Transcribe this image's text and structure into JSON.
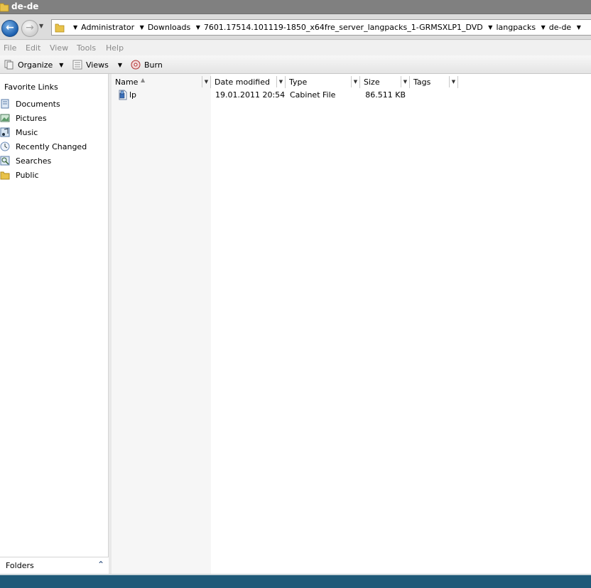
{
  "window": {
    "title": "de-de"
  },
  "address": {
    "crumbs": [
      "Administrator",
      "Downloads",
      "7601.17514.101119-1850_x64fre_server_langpacks_1-GRMSXLP1_DVD",
      "langpacks",
      "de-de"
    ]
  },
  "menu": {
    "items": [
      "File",
      "Edit",
      "View",
      "Tools",
      "Help"
    ]
  },
  "toolbar": {
    "organize_label": "Organize",
    "views_label": "Views",
    "burn_label": "Burn"
  },
  "nav": {
    "favorites_title": "Favorite Links",
    "items": [
      {
        "label": "Documents",
        "icon": "documents-icon"
      },
      {
        "label": "Pictures",
        "icon": "pictures-icon"
      },
      {
        "label": "Music",
        "icon": "music-icon"
      },
      {
        "label": "Recently Changed",
        "icon": "recently-changed-icon"
      },
      {
        "label": "Searches",
        "icon": "searches-icon"
      },
      {
        "label": "Public",
        "icon": "public-folder-icon"
      }
    ],
    "folders_label": "Folders"
  },
  "columns": [
    "Name",
    "Date modified",
    "Type",
    "Size",
    "Tags"
  ],
  "files": [
    {
      "name": "lp",
      "date_modified": "19.01.2011 20:54",
      "type": "Cabinet File",
      "size": "86.511 KB",
      "tags": "",
      "icon": "cabinet-file-icon"
    }
  ],
  "colors": {
    "titlebar": "#808080",
    "taskbar": "#1f5a79",
    "back_button": "#1c5fae"
  }
}
